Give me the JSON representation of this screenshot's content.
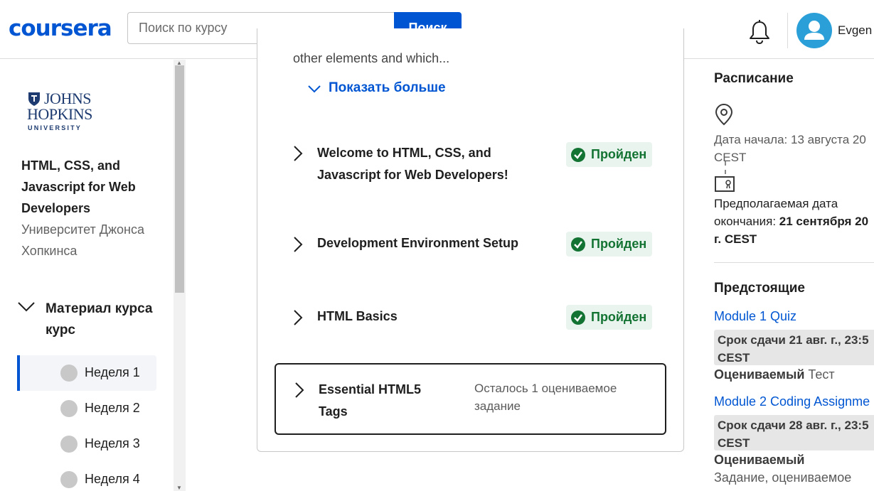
{
  "header": {
    "logo": "coursera",
    "search_placeholder": "Поиск по курсу",
    "search_button": "Поиск",
    "user_name": "Evgen"
  },
  "sidebar": {
    "partner": {
      "line1": "JOHNS",
      "line2": "HOPKINS",
      "line3": "UNIVERSITY"
    },
    "course_title": "HTML, CSS, and Javascript for Web Developers",
    "course_org": "Университет Джонса Хопкинса",
    "materials_label": "Материал курса курс",
    "weeks": [
      {
        "label": "Неделя 1",
        "active": true
      },
      {
        "label": "Неделя 2",
        "active": false
      },
      {
        "label": "Неделя 3",
        "active": false
      },
      {
        "label": "Неделя 4",
        "active": false
      }
    ]
  },
  "main": {
    "cut_text": "other elements and which...",
    "show_more": "Показать больше",
    "modules": [
      {
        "title": "Welcome to HTML, CSS, and Javascript for Web Developers!",
        "status": "Пройден"
      },
      {
        "title": "Development Environment Setup",
        "status": "Пройден"
      },
      {
        "title": "HTML Basics",
        "status": "Пройден"
      },
      {
        "title": "Essential HTML5 Tags",
        "remaining": "Осталось 1 оцениваемое задание"
      }
    ]
  },
  "right": {
    "schedule_title": "Расписание",
    "start_label": "Дата начала:",
    "start_value": "13 августа 20",
    "start_tz": "CEST",
    "end_label_1": "Предполагаемая дата",
    "end_label_2": "окончания:",
    "end_value": "21 сентября 20",
    "end_value_2": "г. CEST",
    "upcoming_title": "Предстоящие",
    "upcoming": [
      {
        "name": "Module 1 Quiz",
        "due_1": "Срок сдачи 21 авг. г., 23:5",
        "due_2": "CEST",
        "graded": "Оцениваемый",
        "type": "Тест"
      },
      {
        "name": "Module 2 Coding Assignme",
        "due_1": "Срок сдачи 28 авг. г., 23:5",
        "due_2": "CEST",
        "graded": "Оцениваемый",
        "type": "Задание, оцениваемое"
      }
    ]
  },
  "colors": {
    "brand": "#0056d2",
    "passed": "#137333",
    "passed_bg": "#eaf4ee"
  }
}
